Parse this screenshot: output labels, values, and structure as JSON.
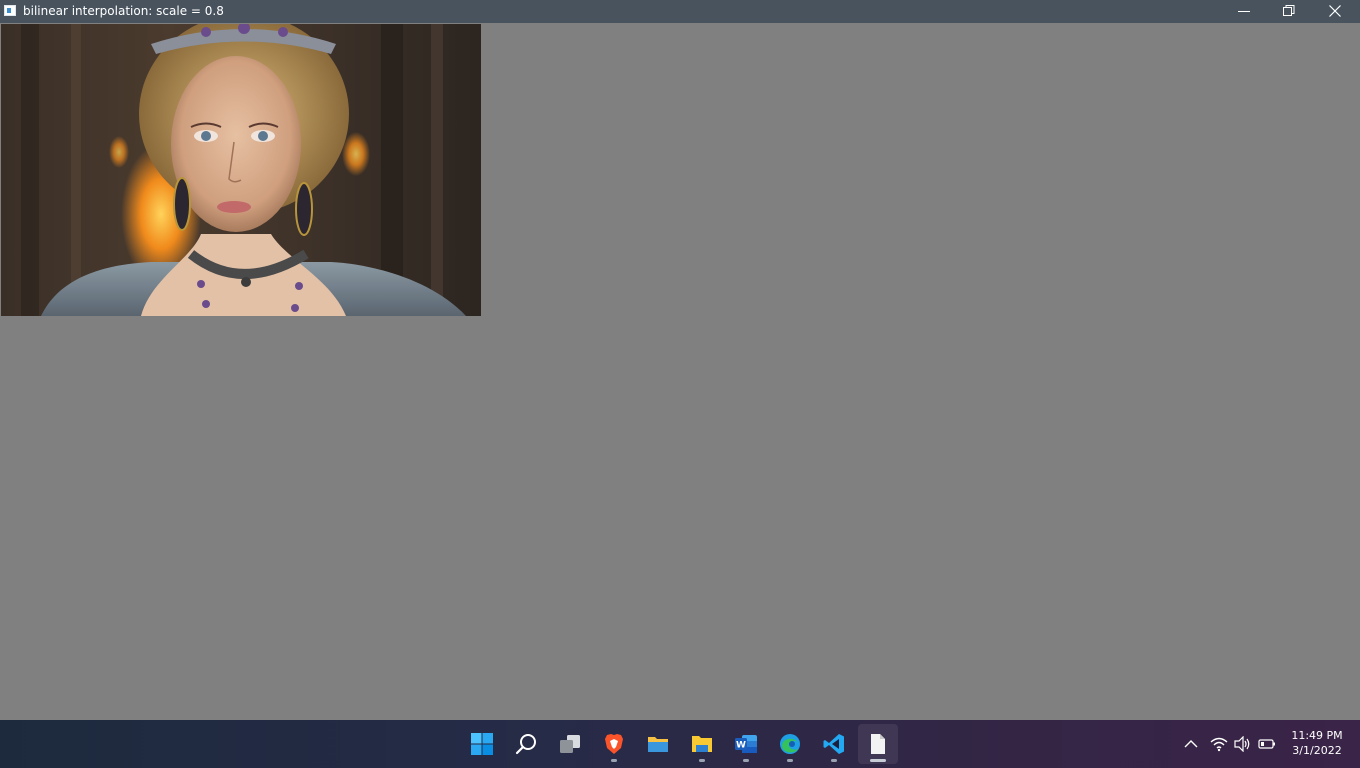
{
  "window": {
    "title": "bilinear interpolation: scale = 0.8",
    "controls": [
      "minimize-icon",
      "restore-icon",
      "close-icon"
    ]
  },
  "canvas": {
    "background": "#808080",
    "image_description_icon": "photo-portrait"
  },
  "taskbar": {
    "apps": [
      {
        "name": "start",
        "icon": "windows-logo-icon",
        "running": false
      },
      {
        "name": "search",
        "icon": "search-icon",
        "running": false
      },
      {
        "name": "task-view",
        "icon": "task-view-icon",
        "running": false
      },
      {
        "name": "brave",
        "icon": "brave-browser-icon",
        "running": true
      },
      {
        "name": "file-explorer",
        "icon": "folder-icon",
        "running": false
      },
      {
        "name": "file-explorer-2",
        "icon": "folder-open-icon",
        "running": true
      },
      {
        "name": "word",
        "icon": "word-icon",
        "running": true
      },
      {
        "name": "edge",
        "icon": "edge-icon",
        "running": true
      },
      {
        "name": "vscode",
        "icon": "vscode-icon",
        "running": true
      },
      {
        "name": "image-window",
        "icon": "document-icon",
        "running": true,
        "active": true
      }
    ],
    "tray": {
      "icons": [
        "chevron-up-icon",
        "wifi-icon",
        "volume-icon",
        "battery-icon"
      ],
      "time": "11:49 PM",
      "date": "3/1/2022"
    }
  },
  "colors": {
    "titlebar": "#48535e",
    "desktop": "#808080",
    "accent": "#0078d4"
  }
}
